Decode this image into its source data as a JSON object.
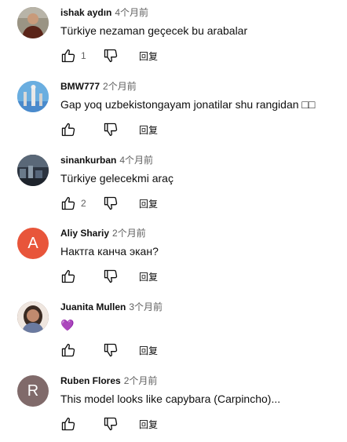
{
  "comments": [
    {
      "author": "ishak aydın",
      "time": "4个月前",
      "text": "Türkiye nezaman geçecek bu arabalar",
      "likes": "1",
      "reply_label": "回复",
      "avatar_type": "photo-man",
      "avatar_color": "#8a8070"
    },
    {
      "author": "BMW777",
      "time": "2个月前",
      "text": "Gap yoq uzbekistongayam jonatilar shu rangidan □□",
      "likes": "",
      "reply_label": "回复",
      "avatar_type": "photo-statue",
      "avatar_color": "#5aa0d8"
    },
    {
      "author": "sinankurban",
      "time": "4个月前",
      "text": "Türkiye gelecekmi araç",
      "likes": "2",
      "reply_label": "回复",
      "avatar_type": "photo-city",
      "avatar_color": "#2a3038"
    },
    {
      "author": "Aliy Shariy",
      "time": "2个月前",
      "text": "Нактга канча экан?",
      "likes": "",
      "reply_label": "回复",
      "avatar_type": "letter",
      "avatar_letter": "A",
      "avatar_color": "#e8553a"
    },
    {
      "author": "Juanita Mullen",
      "time": "3个月前",
      "text": "💜",
      "likes": "",
      "reply_label": "回复",
      "avatar_type": "photo-woman",
      "avatar_color": "#6a4a3a"
    },
    {
      "author": "Ruben Flores",
      "time": "2个月前",
      "text": "This model looks like capybara (Carpincho)...",
      "likes": "",
      "reply_label": "回复",
      "avatar_type": "letter",
      "avatar_letter": "R",
      "avatar_color": "#806a6a"
    }
  ],
  "icons": {
    "like": "thumb-up-icon",
    "dislike": "thumb-down-icon"
  }
}
